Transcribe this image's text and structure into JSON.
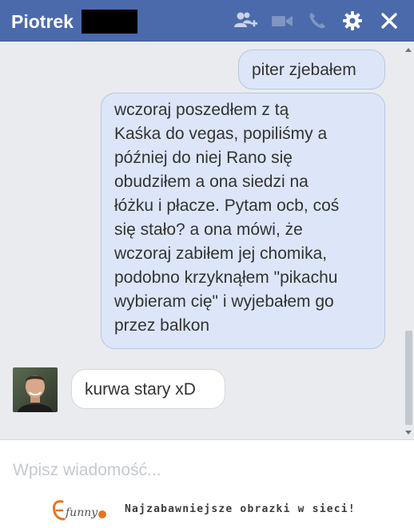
{
  "header": {
    "contact_name": "Piotrek",
    "icons": [
      "add-friend-icon",
      "video-call-icon",
      "phone-icon",
      "gear-icon",
      "close-icon"
    ],
    "background_color": "#4b6aab"
  },
  "messages": [
    {
      "sender": "me",
      "text": "piter zjebałem"
    },
    {
      "sender": "me",
      "lines": [
        "wczoraj poszedłem z tą",
        "Kaśka do vegas, popiliśmy a",
        "później do niej Rano się",
        "obudziłem a ona siedzi na",
        "łóżku i płacze. Pytam ocb, coś",
        "się stało? a ona mówi, że",
        "wczoraj zabiłem jej chomika,",
        "podobno krzyknąłem \"pikachu",
        "wybieram cię\" i wyjebałem go",
        "przez balkon"
      ]
    },
    {
      "sender": "them",
      "text": "kurwa stary xD"
    }
  ],
  "composer": {
    "placeholder": "Wpisz wiadomość..."
  },
  "footer": {
    "logo_text": "funny",
    "tagline": "Najzabawniejsze obrazki w sieci!"
  }
}
